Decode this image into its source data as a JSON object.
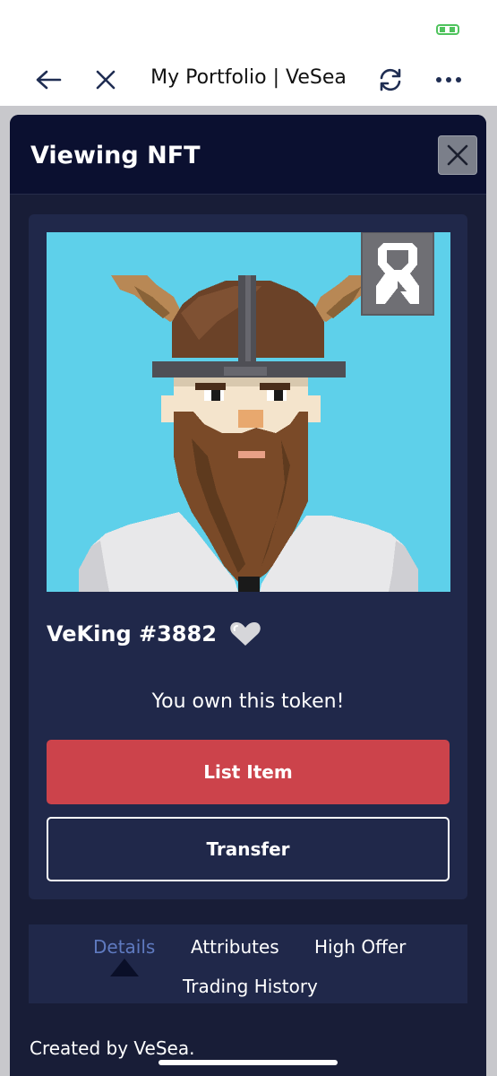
{
  "browser": {
    "title": "My Portfolio | VeSea",
    "back_icon": "arrow-left-icon",
    "close_icon": "close-icon",
    "refresh_icon": "refresh-icon",
    "more_icon": "more-horizontal-icon"
  },
  "modal": {
    "title": "Viewing NFT",
    "close_icon": "close-icon"
  },
  "nft": {
    "name": "VeKing #3882",
    "favorite_icon": "heart-icon",
    "ownership_text": "You own this token!",
    "image_description": "pixel-art-viking-king"
  },
  "actions": {
    "list_label": "List Item",
    "transfer_label": "Transfer"
  },
  "tabs": [
    {
      "label": "Details",
      "active": true
    },
    {
      "label": "Attributes",
      "active": false
    },
    {
      "label": "High Offer",
      "active": false
    },
    {
      "label": "Trading History",
      "active": false
    }
  ],
  "footer": {
    "created_by": "Created by VeSea."
  },
  "colors": {
    "modal_bg": "#181d37",
    "header_bg": "#0b1030",
    "card_bg": "#20284a",
    "list_button": "#cc434b",
    "active_tab": "#5f7ac0",
    "nft_background": "#5ed0ea"
  }
}
